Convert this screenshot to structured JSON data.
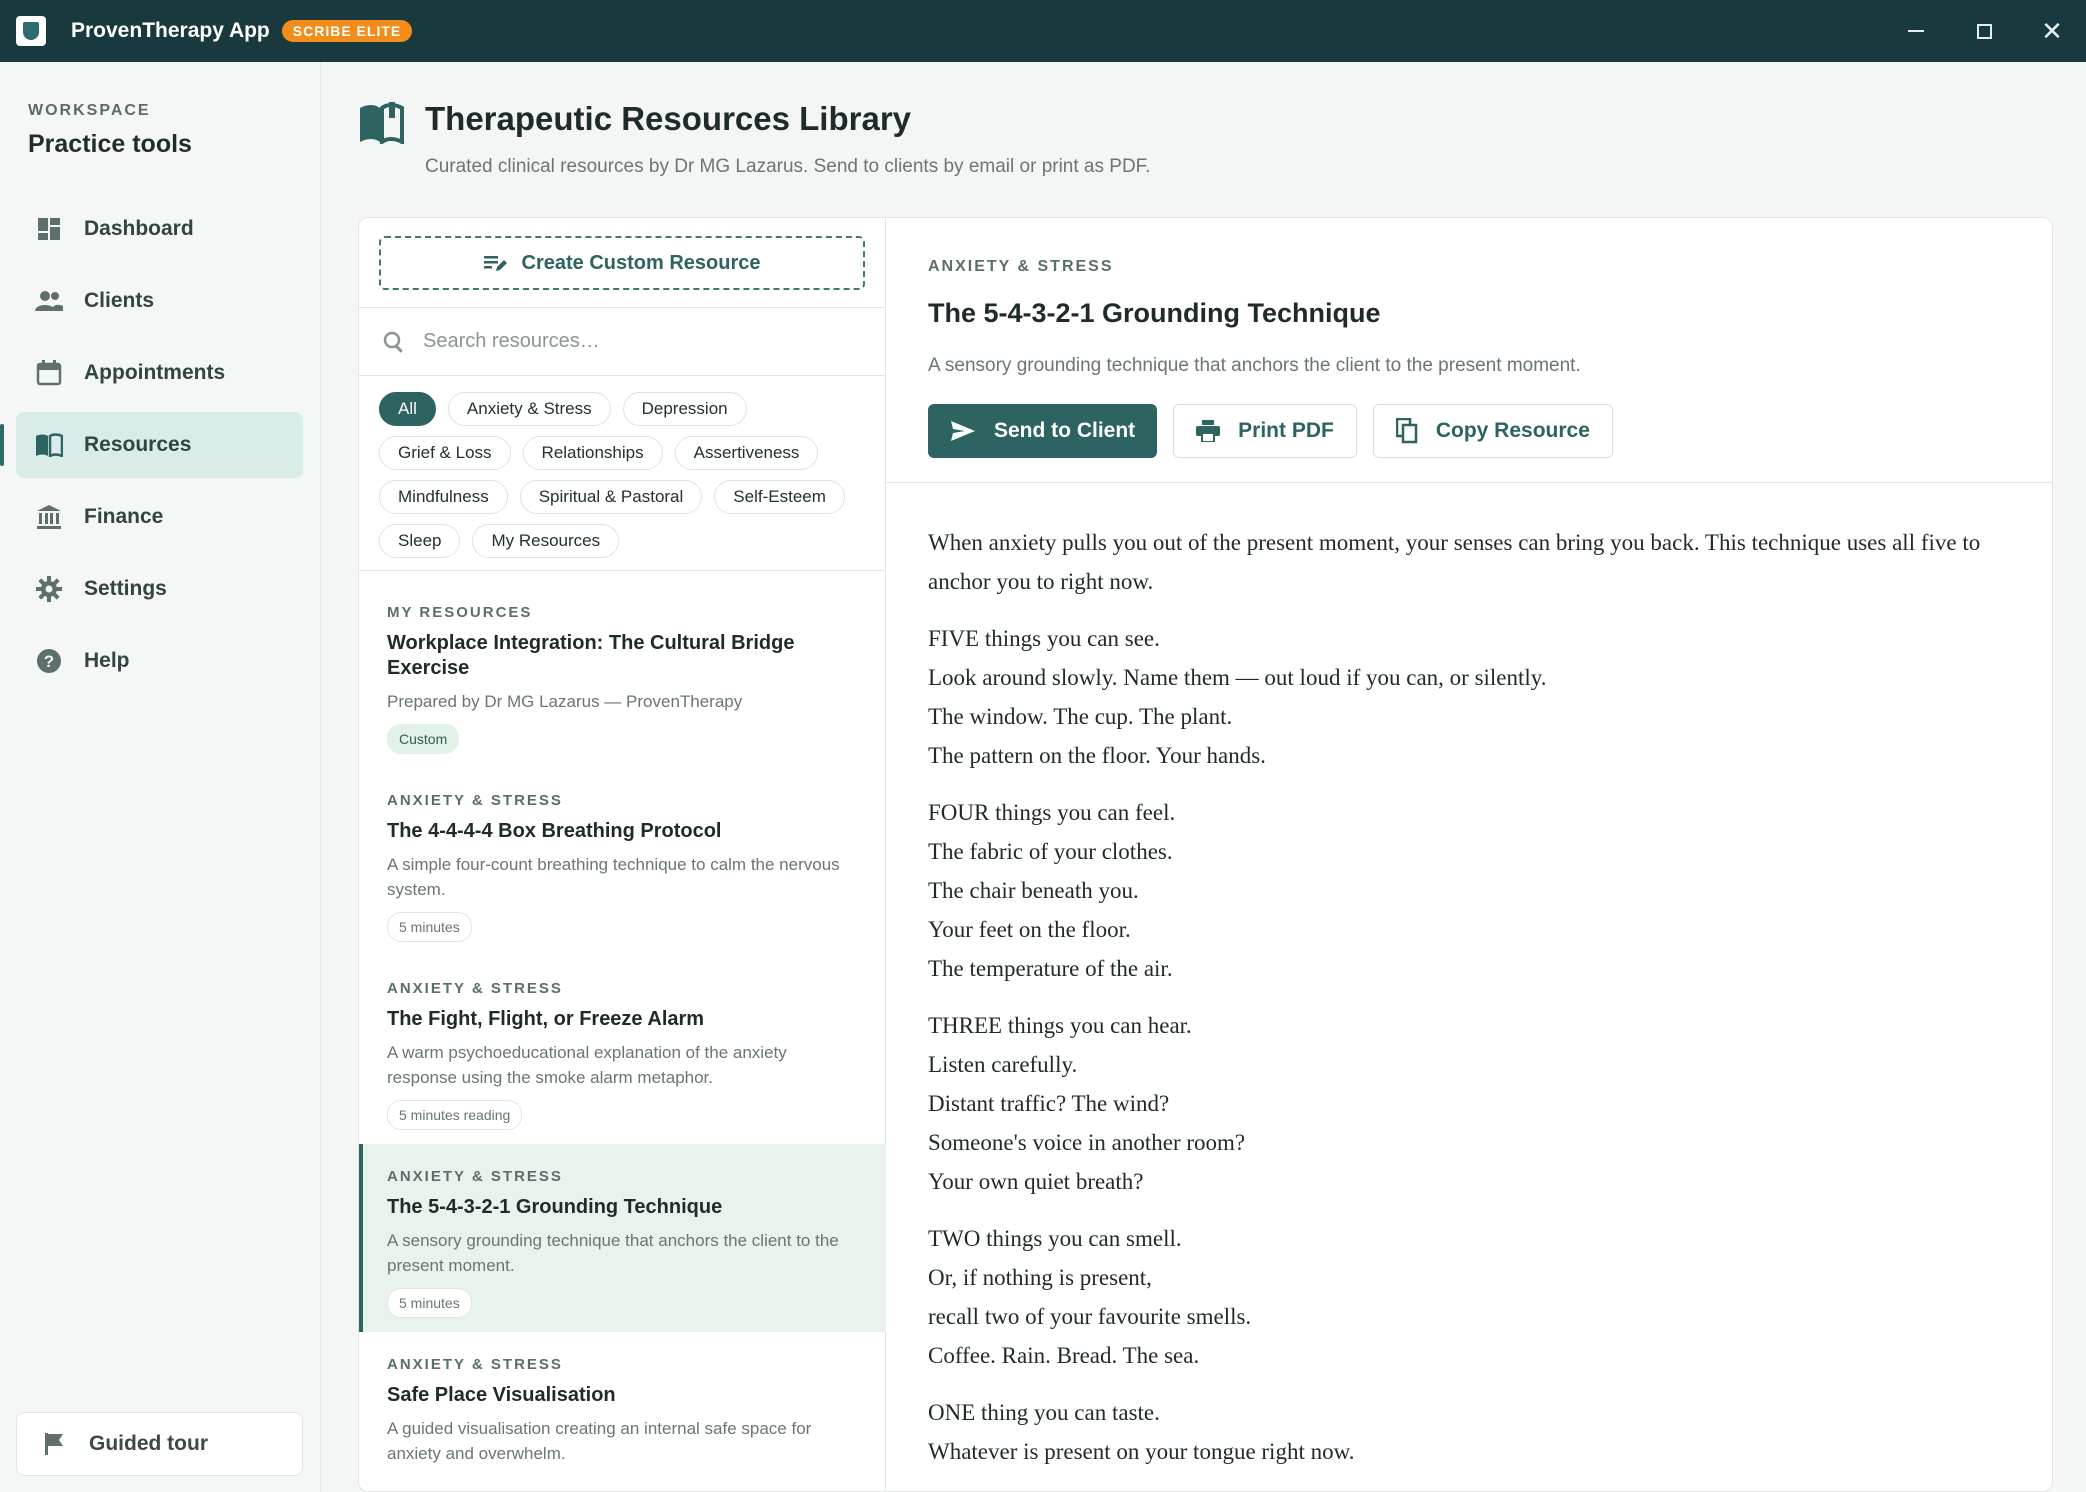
{
  "titlebar": {
    "app_name": "ProvenTherapy App",
    "badge": "SCRIBE ELITE",
    "controls": [
      "minimize-icon",
      "maximize-icon",
      "close-icon"
    ]
  },
  "sidebar": {
    "workspace_label": "WORKSPACE",
    "workspace_title": "Practice tools",
    "items": [
      {
        "label": "Dashboard",
        "icon": "dashboard-icon"
      },
      {
        "label": "Clients",
        "icon": "people-icon"
      },
      {
        "label": "Appointments",
        "icon": "calendar-icon"
      },
      {
        "label": "Resources",
        "icon": "book-icon",
        "active": true
      },
      {
        "label": "Finance",
        "icon": "bank-icon"
      },
      {
        "label": "Settings",
        "icon": "gear-icon"
      },
      {
        "label": "Help",
        "icon": "help-icon"
      }
    ],
    "guided_tour": "Guided tour"
  },
  "header": {
    "title": "Therapeutic Resources Library",
    "subtitle": "Curated clinical resources by Dr MG Lazarus. Send to clients by email or print as PDF."
  },
  "library": {
    "create_label": "Create Custom Resource",
    "search_placeholder": "Search resources…",
    "search_value": "",
    "filters": [
      "All",
      "Anxiety & Stress",
      "Depression",
      "Grief & Loss",
      "Relationships",
      "Assertiveness",
      "Mindfulness",
      "Spiritual & Pastoral",
      "Self-Esteem",
      "Sleep",
      "My Resources"
    ],
    "active_filter": "All",
    "resources": [
      {
        "category": "MY RESOURCES",
        "title": "Workplace Integration: The Cultural Bridge Exercise",
        "description": "Prepared by Dr MG Lazarus — ProvenTherapy",
        "tag": "Custom"
      },
      {
        "category": "ANXIETY & STRESS",
        "title": "The 4-4-4-4 Box Breathing Protocol",
        "description": "A simple four-count breathing technique to calm the nervous system.",
        "tag": "5 minutes"
      },
      {
        "category": "ANXIETY & STRESS",
        "title": "The Fight, Flight, or Freeze Alarm",
        "description": "A warm psychoeducational explanation of the anxiety response using the smoke alarm metaphor.",
        "tag": "5 minutes reading"
      },
      {
        "category": "ANXIETY & STRESS",
        "title": "The 5-4-3-2-1 Grounding Technique",
        "description": "A sensory grounding technique that anchors the client to the present moment.",
        "tag": "5 minutes",
        "selected": true
      },
      {
        "category": "ANXIETY & STRESS",
        "title": "Safe Place Visualisation",
        "description": "A guided visualisation creating an internal safe space for anxiety and overwhelm."
      }
    ]
  },
  "detail": {
    "category": "ANXIETY & STRESS",
    "title": "The 5-4-3-2-1 Grounding Technique",
    "description": "A sensory grounding technique that anchors the client to the present moment.",
    "actions": {
      "send": "Send to Client",
      "print": "Print PDF",
      "copy": "Copy Resource"
    },
    "body": [
      [
        "When anxiety pulls you out of the present moment, your senses can bring you back. This technique uses all five to anchor you to right now."
      ],
      [
        "FIVE things you can see.",
        "Look around slowly. Name them — out loud if you can, or silently.",
        "The window. The cup. The plant.",
        "The pattern on the floor. Your hands."
      ],
      [
        "FOUR things you can feel.",
        "The fabric of your clothes.",
        "The chair beneath you.",
        "Your feet on the floor.",
        "The temperature of the air."
      ],
      [
        "THREE things you can hear.",
        "Listen carefully.",
        "Distant traffic? The wind?",
        "Someone's voice in another room?",
        "Your own quiet breath?"
      ],
      [
        "TWO things you can smell.",
        "Or, if nothing is present,",
        "recall two of your favourite smells.",
        "Coffee. Rain. Bread. The sea."
      ],
      [
        "ONE thing you can taste.",
        "Whatever is present on your tongue right now."
      ]
    ]
  },
  "colors": {
    "titlebar": "#183a3f",
    "accent": "#2d6360",
    "badge": "#f28c1a",
    "selected_bg": "#e8f3ec"
  }
}
